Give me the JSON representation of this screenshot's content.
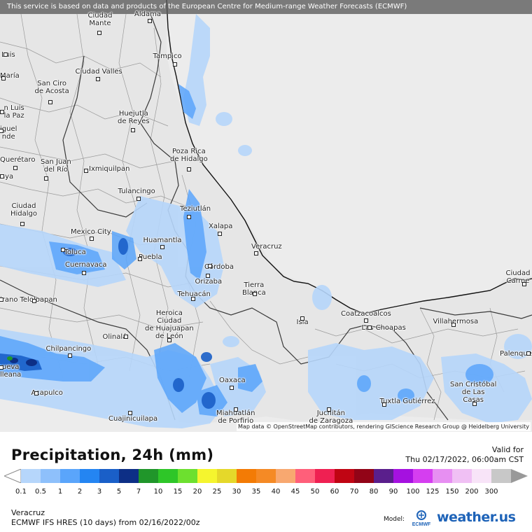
{
  "banner": "This service is based on data and products of the European Centre for Medium-range Weather Forecasts (ECMWF)",
  "attribution": "Map data © OpenStreetMap contributors, rendering GIScience Research Group @ Heidelberg University",
  "cities": [
    {
      "id": "ciudad-mante",
      "label": "Ciudad\nMante"
    },
    {
      "id": "aldama",
      "label": "Aldama"
    },
    {
      "id": "tampico",
      "label": "Tampico"
    },
    {
      "id": "ciudad-valles",
      "label": "Ciudad Valles"
    },
    {
      "id": "san-ciro",
      "label": "San Ciro\nde Acosta"
    },
    {
      "id": "huejutla",
      "label": "Huejutla\nde Reyes"
    },
    {
      "id": "poza-rica",
      "label": "Poza Rica\nde Hidalgo"
    },
    {
      "id": "queretaro",
      "label": "Querétaro"
    },
    {
      "id": "san-juan-del-rio",
      "label": "San Juan\ndel Río"
    },
    {
      "id": "ixmiquilpan",
      "label": "Ixmiquilpan"
    },
    {
      "id": "tulancingo",
      "label": "Tulancingo"
    },
    {
      "id": "teziutlan",
      "label": "Teziutlán"
    },
    {
      "id": "ciudad-hidalgo",
      "label": "Ciudad\nHidalgo"
    },
    {
      "id": "xalapa",
      "label": "Xalapa"
    },
    {
      "id": "mexico-city",
      "label": "Mexico City"
    },
    {
      "id": "huamantla",
      "label": "Huamantla"
    },
    {
      "id": "veracruz",
      "label": "Veracruz"
    },
    {
      "id": "toluca",
      "label": "Toluca"
    },
    {
      "id": "cuernavaca",
      "label": "Cuernavaca"
    },
    {
      "id": "puebla",
      "label": "Puebla"
    },
    {
      "id": "cordoba",
      "label": "Córdoba"
    },
    {
      "id": "orizaba",
      "label": "Orizaba"
    },
    {
      "id": "tierra-blanca",
      "label": "Tierra\nBlanca"
    },
    {
      "id": "tehuacan",
      "label": "Tehuacán"
    },
    {
      "id": "teloloapan",
      "label": "Teloloapan"
    },
    {
      "id": "heroica",
      "label": "Heroica\nCiudad\nde Huajuapan\nde León"
    },
    {
      "id": "coatzacoalcos",
      "label": "Coatzacoalcos"
    },
    {
      "id": "isla",
      "label": "Isla"
    },
    {
      "id": "las-choapas",
      "label": "Las Choapas"
    },
    {
      "id": "villahermosa",
      "label": "Villahermosa"
    },
    {
      "id": "ciudad-del-carmen",
      "label": "Ciudad\nCarme"
    },
    {
      "id": "olinala",
      "label": "Olinalá"
    },
    {
      "id": "chilpancingo",
      "label": "Chilpancingo"
    },
    {
      "id": "palenque",
      "label": "Palenque"
    },
    {
      "id": "oaxaca",
      "label": "Oaxaca"
    },
    {
      "id": "san-cristobal",
      "label": "San Cristóbal\nde Las\nCasas"
    },
    {
      "id": "acapulco",
      "label": "Acapulco"
    },
    {
      "id": "tuxtla",
      "label": "Tuxtla Gutiérrez"
    },
    {
      "id": "miahuatlan",
      "label": "Miahuatlán\nde Porfirio"
    },
    {
      "id": "juchitan",
      "label": "Juchitán\nde Zaragoza"
    },
    {
      "id": "cuajinicuilapa",
      "label": "Cuajinicuilapa"
    },
    {
      "id": "luis",
      "label": "Luis"
    },
    {
      "id": "maria",
      "label": "María"
    },
    {
      "id": "san-luis-la-paz",
      "label": "n Luis\nla Paz"
    },
    {
      "id": "miguel",
      "label": "iguel\nnde"
    },
    {
      "id": "celaya",
      "label": "aya"
    },
    {
      "id": "pirano",
      "label": "irano"
    },
    {
      "id": "zacatula",
      "label": "ueva\nlleana"
    }
  ],
  "legend": {
    "title": "Precipitation, 24h (mm)",
    "valid_label": "Valid for",
    "valid_time": "Thu 02/17/2022, 06:00am CST",
    "ticks": [
      "0.1",
      "0.5",
      "1",
      "2",
      "3",
      "5",
      "7",
      "10",
      "15",
      "20",
      "25",
      "30",
      "35",
      "40",
      "45",
      "50",
      "60",
      "70",
      "80",
      "90",
      "100",
      "125",
      "150",
      "200",
      "300"
    ],
    "colors": [
      "#b6d6fb",
      "#8ec0fb",
      "#5aa5fb",
      "#2485f2",
      "#1a5fc8",
      "#0d2f86",
      "#20962a",
      "#2ec628",
      "#6de02f",
      "#f5f52e",
      "#e5d82a",
      "#f37b05",
      "#f58a25",
      "#f8a870",
      "#ff5f7a",
      "#ef2052",
      "#c00513",
      "#920417",
      "#5a1f8c",
      "#a511e0",
      "#d53ef0",
      "#e78ff2",
      "#f0c0f4",
      "#f8e4f8",
      "#c8c8c8"
    ]
  },
  "location": "Veracruz",
  "model_line": "ECMWF IFS HRES (10 days) from 02/16/2022/00z",
  "model_label": "Model:",
  "ecmwf_logo_text": "ECMWF",
  "brand": "weather.us"
}
